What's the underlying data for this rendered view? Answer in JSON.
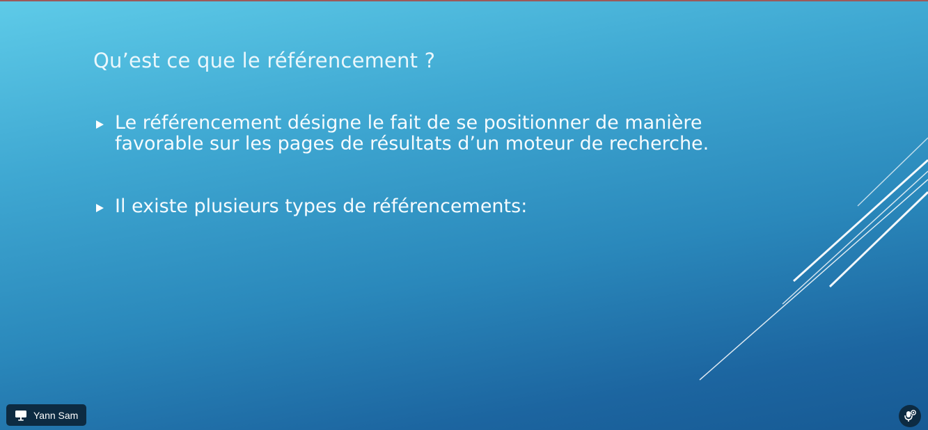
{
  "slide": {
    "title": "Qu’est ce que le référencement ?",
    "bullets": [
      {
        "text": "Le référencement désigne le fait de se positionner de manière\nfavorable sur les pages de résultats d’un moteur de recherche."
      },
      {
        "text": "Il existe plusieurs types de référencements:"
      }
    ]
  },
  "presenter": {
    "name": "Yann Sam",
    "icon": "screen-share-icon"
  },
  "controls": {
    "mic_icon": "microphone-icon"
  },
  "colors": {
    "background_top": "#5ecbe8",
    "background_bottom": "#175a94",
    "badge": "#0d2b42",
    "text": "#ffffff"
  }
}
